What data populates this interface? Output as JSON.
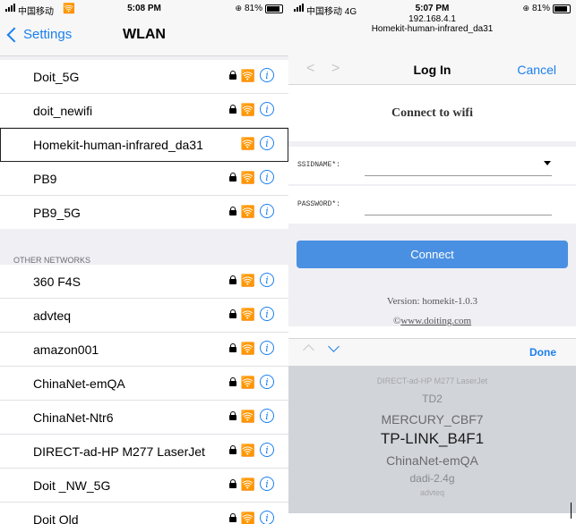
{
  "left_status": {
    "carrier": "中国移动",
    "time": "5:08 PM",
    "battery": "81%"
  },
  "left_nav": {
    "back_label": "Settings",
    "title": "WLAN"
  },
  "networks_top": [
    {
      "name": "Doit_5G",
      "locked": true
    },
    {
      "name": "doit_newifi",
      "locked": true
    },
    {
      "name": "Homekit-human-infrared_da31",
      "locked": false,
      "highlighted": true
    },
    {
      "name": "PB9",
      "locked": true
    },
    {
      "name": "PB9_5G",
      "locked": true
    }
  ],
  "other_networks_header": "OTHER NETWORKS",
  "networks_other": [
    {
      "name": "360 F4S",
      "locked": true
    },
    {
      "name": "advteq",
      "locked": true
    },
    {
      "name": "amazon001",
      "locked": true
    },
    {
      "name": "ChinaNet-emQA",
      "locked": true
    },
    {
      "name": "ChinaNet-Ntr6",
      "locked": true
    },
    {
      "name": "DIRECT-ad-HP M277 LaserJet",
      "locked": true
    },
    {
      "name": "Doit _NW_5G",
      "locked": true
    },
    {
      "name": "Doit Old",
      "locked": true
    }
  ],
  "right_status": {
    "carrier": "中国移动 4G",
    "time": "5:07 PM",
    "battery": "81%"
  },
  "portal": {
    "ip": "192.168.4.1",
    "host": "Homekit-human-infrared_da31"
  },
  "right_nav": {
    "prev": "<",
    "next": ">",
    "title": "Log In",
    "cancel": "Cancel"
  },
  "form": {
    "title": "Connect to wifi",
    "ssid_label": "SSIDNAME*:",
    "ssid_value": "",
    "password_label": "PASSWORD*:",
    "connect_label": "Connect",
    "version": "Version: homekit-1.0.3",
    "copyright_symbol": "©",
    "site": "www.doiting.com"
  },
  "accessory": {
    "done_label": "Done"
  },
  "picker_options": [
    "DIRECT-ad-HP M277 LaserJet",
    "TD2",
    "MERCURY_CBF7",
    "TP-LINK_B4F1",
    "ChinaNet-emQA",
    "dadi-2.4g",
    "advteq"
  ],
  "picker_selected_index": 3
}
